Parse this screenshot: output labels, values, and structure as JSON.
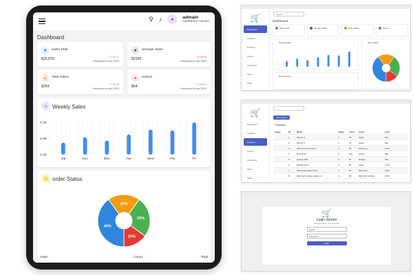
{
  "app": {
    "title": "Dashboard"
  },
  "user": {
    "name": "admain",
    "role": "DashBord Admain"
  },
  "stats": [
    {
      "name": "Sales Total",
      "value": "$25,970",
      "change": "↑ 2.03 %",
      "direction": "up",
      "compare": "Compared to dec 2023",
      "color": "#3f8ef5",
      "bg": "#e3efff"
    },
    {
      "name": "average Sales",
      "value": "$2150",
      "change": "↓ 0.23 %",
      "direction": "down",
      "compare": "Compared to dec 2023",
      "color": "#6d5a4a",
      "bg": "#eee4db"
    },
    {
      "name": "Total orders",
      "value": "$254",
      "change": "↑ 1.03 %",
      "direction": "up",
      "compare": "Compared to dec 2023",
      "color": "#f08a3c",
      "bg": "#fde9da"
    },
    {
      "name": "visitors",
      "value": "$54",
      "change": "↑ 0.45 %",
      "direction": "up",
      "compare": "Compared to dec 2023",
      "color": "#e0507a",
      "bg": "#fde3ea"
    }
  ],
  "weekly": {
    "title": "Weekly Sales",
    "ylabels": [
      "4.0K",
      "2.0K",
      "0.0K"
    ]
  },
  "chart_data": [
    {
      "type": "bar",
      "title": "Weekly Sales",
      "categories": [
        "Sat",
        "Sun",
        "Mon",
        "Tue",
        "Wed",
        "Thu",
        "Fri"
      ],
      "values": [
        1500,
        2150,
        1750,
        2500,
        3100,
        3000,
        4000
      ],
      "ylim": [
        0,
        4000
      ],
      "ylabels": [
        "4.0K",
        "2.0K",
        "0.0K"
      ],
      "color": "#3f8ef5"
    },
    {
      "type": "pie",
      "title": "order Status",
      "slices": [
        {
          "label": "40%",
          "value": 40,
          "color": "#2e86de"
        },
        {
          "label": "20%",
          "value": 20,
          "color": "#f39c12"
        },
        {
          "label": "25%",
          "value": 25,
          "color": "#4caf50"
        },
        {
          "label": "15%",
          "value": 15,
          "color": "#e53935"
        }
      ]
    }
  ],
  "order_status": {
    "title": "order Status"
  },
  "table": {
    "headers": [
      "order",
      "Count",
      "Total"
    ]
  },
  "thumb_dashboard": {
    "title": "Dashboard",
    "search_placeholder": "Search",
    "nav_items": [
      "Dashboard",
      "Analytics",
      "Products",
      "Orders",
      "Customers",
      "Users",
      "Mails",
      "Settings",
      "Log Out"
    ],
    "stats": [
      "Sales Total",
      "average Sales",
      "Total orders",
      "visitors"
    ],
    "weekly": "Weekly Sales",
    "order_status": "order Status",
    "recent": "Recent Order"
  },
  "thumb_products": {
    "title": "Products",
    "add_button": "Add product",
    "nav_items": [
      "Dashboard",
      "Analytics",
      "Products",
      "Orders",
      "Customers",
      "Users",
      "Mails",
      "Settings",
      "Log Out"
    ],
    "headers": [
      "image",
      "ID",
      "Name",
      "rating",
      "stock",
      "brand",
      "price"
    ],
    "rows": [
      [
        "1",
        "iPhone 9",
        "4",
        "94",
        "Apple",
        "549"
      ],
      [
        "2",
        "iPhone X",
        "4",
        "34",
        "Apple",
        "899"
      ],
      [
        "3",
        "Samsung Universe 9",
        "4",
        "36",
        "Samsung",
        "1249"
      ],
      [
        "4",
        "OPPOF19",
        "4",
        "123",
        "OPPO",
        "280"
      ],
      [
        "5",
        "Huawei P30",
        "4",
        "32",
        "Huawei",
        "499"
      ],
      [
        "6",
        "MacBook Pro",
        "4",
        "83",
        "Apple",
        "1749"
      ],
      [
        "7",
        "Samsung Galaxy Book",
        "4",
        "50",
        "Samsung",
        "1499"
      ],
      [
        "8",
        "Microsoft Surface Laptop 4",
        "4",
        "68",
        "Microsoft Surface",
        "1499"
      ]
    ]
  },
  "thumb_login": {
    "title": "Login Screen",
    "subtitle": "please login to your account",
    "email": "Email",
    "password": "Password",
    "button": "Login"
  }
}
